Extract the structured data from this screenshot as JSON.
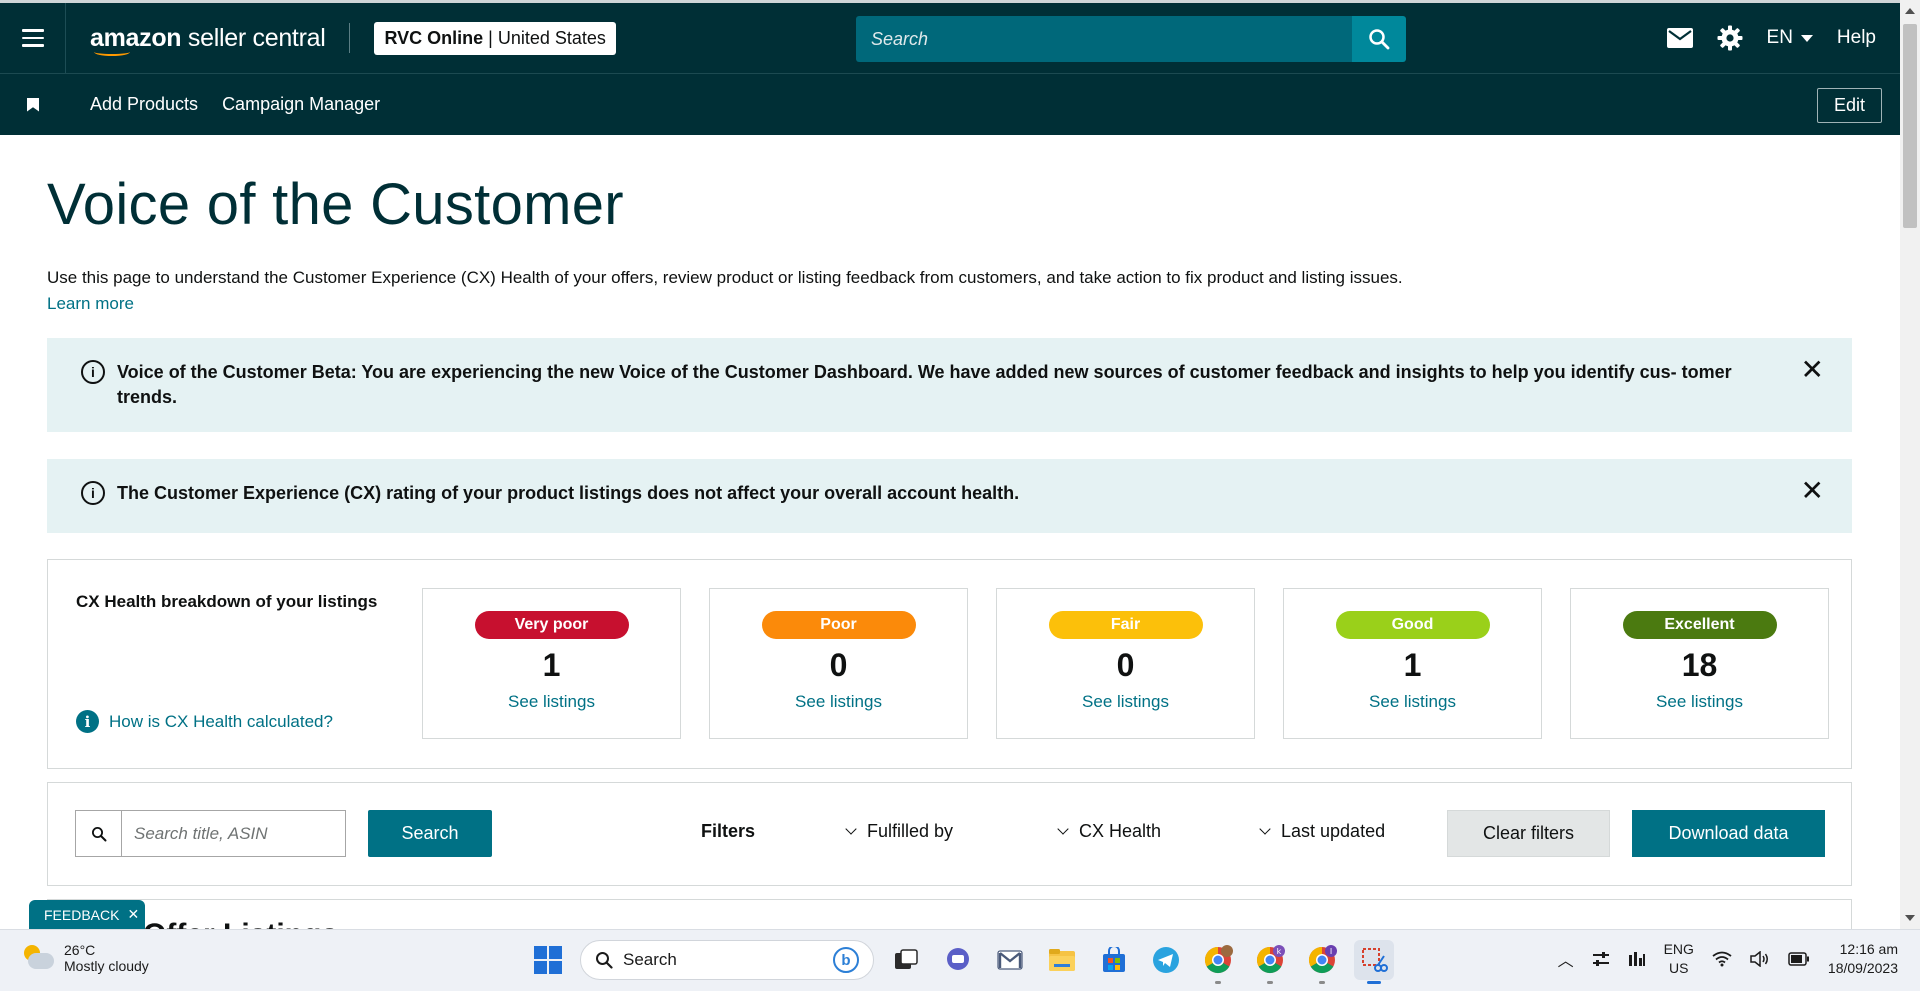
{
  "header": {
    "brand": "amazon seller central",
    "brand_bold": "amazon",
    "brand_rest": " seller central",
    "account_name": "RVC Online",
    "account_region": "United States",
    "search_placeholder": "Search",
    "language": "EN",
    "help_label": "Help"
  },
  "nav": {
    "links": [
      "Add Products",
      "Campaign Manager"
    ],
    "edit_label": "Edit"
  },
  "page": {
    "title": "Voice of the Customer",
    "intro": "Use this page to understand the Customer Experience (CX) Health of your offers, review product or listing feedback from customers, and take action to fix product and listing issues.",
    "learn_more": "Learn more"
  },
  "alerts": [
    {
      "text": "Voice of the Customer Beta: You are experiencing the new Voice of the Customer Dashboard. We have added new sources of customer feedback and insights to help you identify cus- tomer trends."
    },
    {
      "text": "The Customer Experience (CX) rating of your product listings does not affect your overall account health."
    }
  ],
  "cx_health": {
    "label": "CX Health breakdown of your listings",
    "how_link": "How is CX Health calculated?",
    "cards": [
      {
        "label": "Very poor",
        "count": "1",
        "link": "See listings",
        "color": "#c7102f"
      },
      {
        "label": "Poor",
        "count": "0",
        "link": "See listings",
        "color": "#fb8a0a"
      },
      {
        "label": "Fair",
        "count": "0",
        "link": "See listings",
        "color": "#fcc00a"
      },
      {
        "label": "Good",
        "count": "1",
        "link": "See listings",
        "color": "#9ad01a"
      },
      {
        "label": "Excellent",
        "count": "18",
        "link": "See listings",
        "color": "#4b7a10"
      }
    ]
  },
  "filters": {
    "search_placeholder": "Search title, ASIN",
    "search_button": "Search",
    "label": "Filters",
    "dropdowns": [
      "Fulfilled by",
      "CX Health",
      "Last updated"
    ],
    "clear_button": "Clear filters",
    "download_button": "Download data"
  },
  "listings": {
    "title": "Offer Listings"
  },
  "feedback": {
    "label": "FEEDBACK"
  },
  "taskbar": {
    "temperature": "26°C",
    "weather": "Mostly cloudy",
    "search_label": "Search",
    "lang_line1": "ENG",
    "lang_line2": "US",
    "time": "12:16 am",
    "date": "18/09/2023"
  },
  "colors": {
    "header_bg": "#002f36",
    "accent": "#007185",
    "alert_bg": "#e5f2f3"
  }
}
